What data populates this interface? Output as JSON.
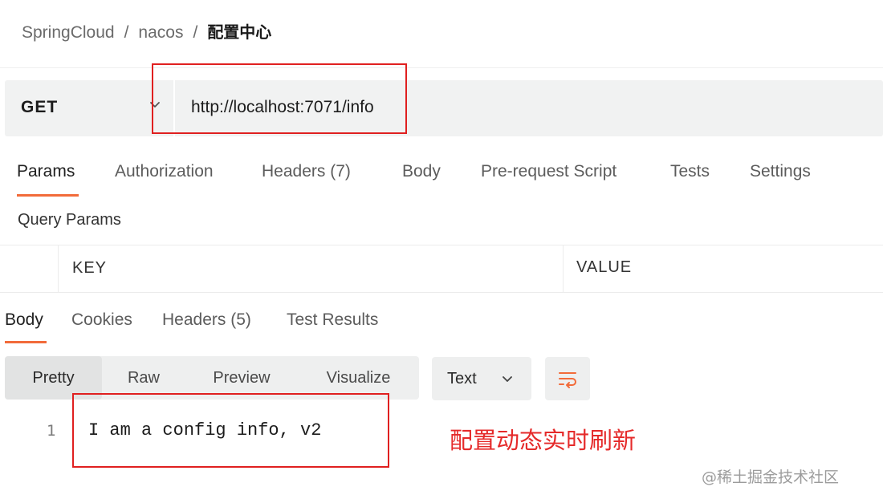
{
  "breadcrumb": {
    "items": [
      "SpringCloud",
      "nacos"
    ],
    "current": "配置中心",
    "separator": "/"
  },
  "request": {
    "method": "GET",
    "url": "http://localhost:7071/info"
  },
  "request_tabs": [
    "Params",
    "Authorization",
    "Headers (7)",
    "Body",
    "Pre-request Script",
    "Tests",
    "Settings"
  ],
  "params": {
    "title": "Query Params",
    "columns": [
      "KEY",
      "VALUE"
    ]
  },
  "response_tabs": [
    "Body",
    "Cookies",
    "Headers (5)",
    "Test Results"
  ],
  "view_modes": [
    "Pretty",
    "Raw",
    "Preview",
    "Visualize"
  ],
  "format": "Text",
  "body": {
    "line_number": "1",
    "text": "I am a config info, v2"
  },
  "annotation": "配置动态实时刷新",
  "watermark": "@稀土掘金技术社区",
  "colors": {
    "accent": "#f26b3a",
    "highlight": "#e02020",
    "annotation": "#e52a2a"
  },
  "icons": {
    "method_dropdown": "chevron-down-icon",
    "format_dropdown": "chevron-down-icon",
    "wrap": "wrap-lines-icon"
  }
}
